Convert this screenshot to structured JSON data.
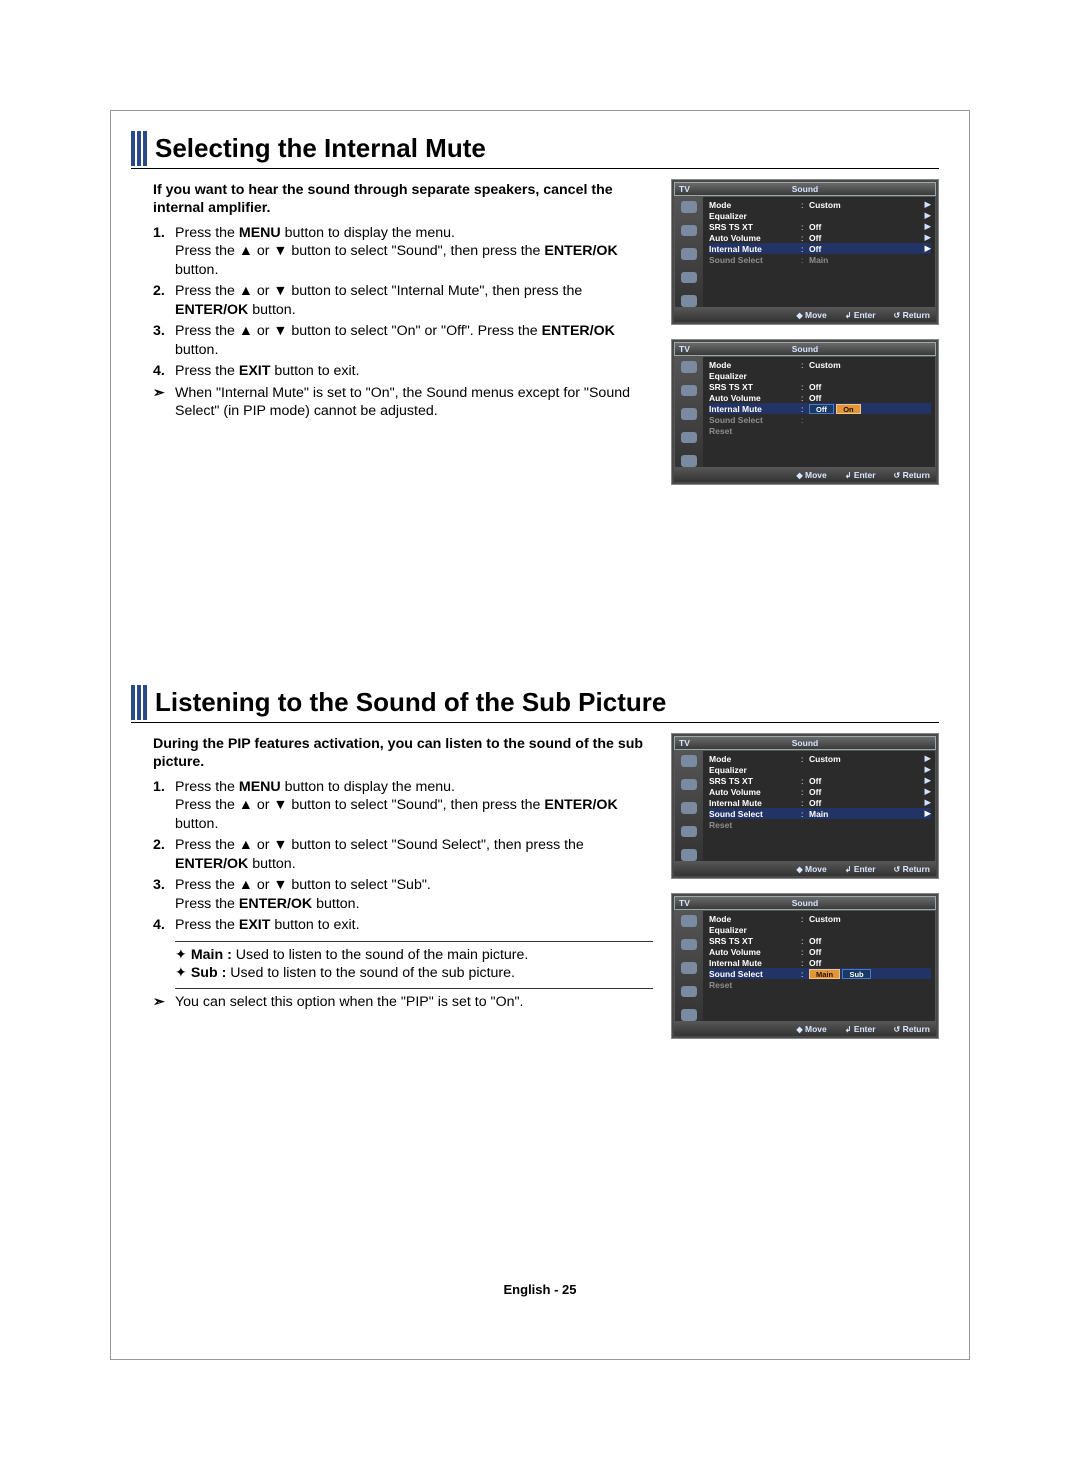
{
  "glyphs": {
    "up": "▲",
    "down": "▼",
    "right": "▶",
    "updown": "◆",
    "enter": "↲",
    "return": "↺",
    "diamond": "✦",
    "tail": "➣"
  },
  "footer": "English - 25",
  "osd_common": {
    "tv": "TV",
    "title": "Sound",
    "footer_move": "Move",
    "footer_enter": "Enter",
    "footer_return": "Return",
    "dim_sound_select": "Sound Select",
    "dim_reset": "Reset"
  },
  "sec1": {
    "title": "Selecting the Internal Mute",
    "intro": "If you want to hear the sound through separate speakers, cancel the internal amplifier.",
    "steps": {
      "s1a": "Press the ",
      "s1b": "MENU",
      "s1c": " button to display the menu.",
      "s1d": "Press the ▲ or ▼ button to select \"Sound\", then press the ",
      "s1e": "ENTER/OK",
      "s1f": " button.",
      "s2a": "Press the ▲ or ▼ button to select \"Internal Mute\", then press the ",
      "s2b": "ENTER/OK",
      "s2c": " button.",
      "s3a": "Press the ▲ or ▼ button to select \"On\" or \"Off\". Press the ",
      "s3b": "ENTER/OK",
      "s3c": " button.",
      "s4a": "Press the ",
      "s4b": "EXIT",
      "s4c": " button to exit.",
      "note": "When \"Internal Mute\" is set to \"On\", the Sound menus except for \"Sound Select\" (in PIP mode) cannot be adjusted."
    },
    "osd1": {
      "rows": [
        {
          "label": "Mode",
          "value": "Custom",
          "arrow": true
        },
        {
          "label": "Equalizer",
          "value": "",
          "arrow": true
        },
        {
          "label": "SRS TS XT",
          "value": "Off",
          "arrow": true
        },
        {
          "label": "Auto Volume",
          "value": "Off",
          "arrow": true
        },
        {
          "label": "Internal Mute",
          "value": "Off",
          "arrow": true,
          "hl": true
        }
      ],
      "dim_value": "Main"
    },
    "osd2": {
      "rows": [
        {
          "label": "Mode",
          "value": "Custom"
        },
        {
          "label": "Equalizer",
          "value": ""
        },
        {
          "label": "SRS TS XT",
          "value": "Off"
        },
        {
          "label": "Auto Volume",
          "value": "Off"
        },
        {
          "label": "Internal Mute",
          "value": "",
          "options": [
            "Off",
            "On"
          ],
          "selected": 1,
          "hl": true
        }
      ]
    }
  },
  "sec2": {
    "title": "Listening to the Sound of the Sub Picture",
    "intro": "During the PIP features activation, you can listen to the sound of the sub picture.",
    "steps": {
      "s1a": "Press the ",
      "s1b": "MENU",
      "s1c": " button to display the menu.",
      "s1d": "Press the ▲ or ▼ button to select \"Sound\", then press the ",
      "s1e": "ENTER/OK",
      "s1f": " button.",
      "s2a": "Press the ▲ or ▼ button to select \"Sound Select\", then press the ",
      "s2b": "ENTER/OK",
      "s2c": " button.",
      "s3a": "Press the ▲ or ▼ button to select \"Sub\".",
      "s3b": "Press the ",
      "s3c": "ENTER/OK",
      "s3d": " button.",
      "s4a": "Press the ",
      "s4b": "EXIT",
      "s4c": " button to exit.",
      "main_l": "Main :",
      "main_t": " Used to listen to the sound of the main picture.",
      "sub_l": "Sub :",
      "sub_t": " Used to listen to the sound of the sub picture.",
      "note": "You can select this option when the \"PIP\" is set to \"On\"."
    },
    "osd1": {
      "rows": [
        {
          "label": "Mode",
          "value": "Custom",
          "arrow": true
        },
        {
          "label": "Equalizer",
          "value": "",
          "arrow": true
        },
        {
          "label": "SRS TS XT",
          "value": "Off",
          "arrow": true
        },
        {
          "label": "Auto Volume",
          "value": "Off",
          "arrow": true
        },
        {
          "label": "Internal Mute",
          "value": "Off",
          "arrow": true
        },
        {
          "label": "Sound Select",
          "value": "Main",
          "arrow": true,
          "hl": true
        }
      ]
    },
    "osd2": {
      "rows": [
        {
          "label": "Mode",
          "value": "Custom"
        },
        {
          "label": "Equalizer",
          "value": ""
        },
        {
          "label": "SRS TS XT",
          "value": "Off"
        },
        {
          "label": "Auto Volume",
          "value": "Off"
        },
        {
          "label": "Internal Mute",
          "value": "Off"
        },
        {
          "label": "Sound Select",
          "value": "",
          "options": [
            "Main",
            "Sub"
          ],
          "selected": 0,
          "hl": true
        }
      ]
    }
  }
}
